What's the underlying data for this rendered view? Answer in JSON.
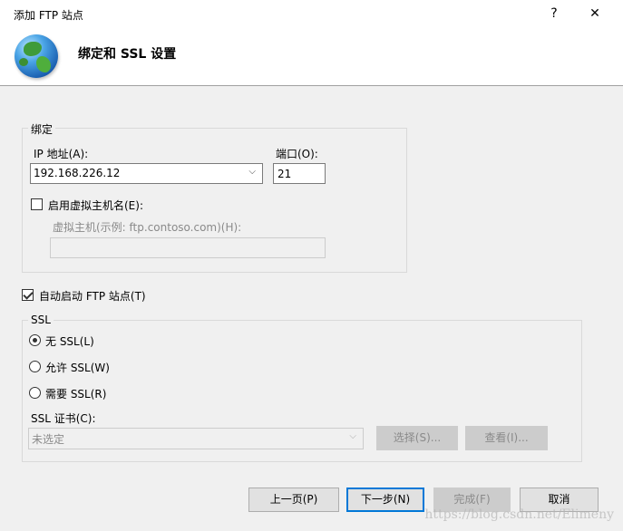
{
  "window": {
    "title": "添加 FTP 站点",
    "help_glyph": "?",
    "close_glyph": "✕"
  },
  "header": {
    "icon": "globe-icon",
    "title": "绑定和 SSL 设置"
  },
  "binding": {
    "group_label": "绑定",
    "ip_label": "IP 地址(A):",
    "ip_value": "192.168.226.12",
    "port_label": "端口(O):",
    "port_value": "21",
    "virtual_host_checkbox_label": "启用虚拟主机名(E):",
    "virtual_host_checked": false,
    "virtual_host_label": "虚拟主机(示例: ftp.contoso.com)(H):",
    "virtual_host_value": ""
  },
  "autostart": {
    "label": "自动启动 FTP 站点(T)",
    "checked": true
  },
  "ssl": {
    "group_label": "SSL",
    "options": [
      {
        "label": "无 SSL(L)",
        "selected": true
      },
      {
        "label": "允许 SSL(W)",
        "selected": false
      },
      {
        "label": "需要 SSL(R)",
        "selected": false
      }
    ],
    "cert_label": "SSL 证书(C):",
    "cert_value": "未选定",
    "select_button": "选择(S)...",
    "view_button": "查看(I)..."
  },
  "footer": {
    "prev_button": "上一页(P)",
    "next_button": "下一步(N)",
    "finish_button": "完成(F)",
    "cancel_button": "取消"
  },
  "watermark": "https://blog.csdn.net/Elimeny",
  "colors": {
    "accent": "#0078d7",
    "dialog_bg": "#f0f0f0",
    "header_bg": "#ffffff",
    "disabled_text": "#8a8a8a"
  }
}
